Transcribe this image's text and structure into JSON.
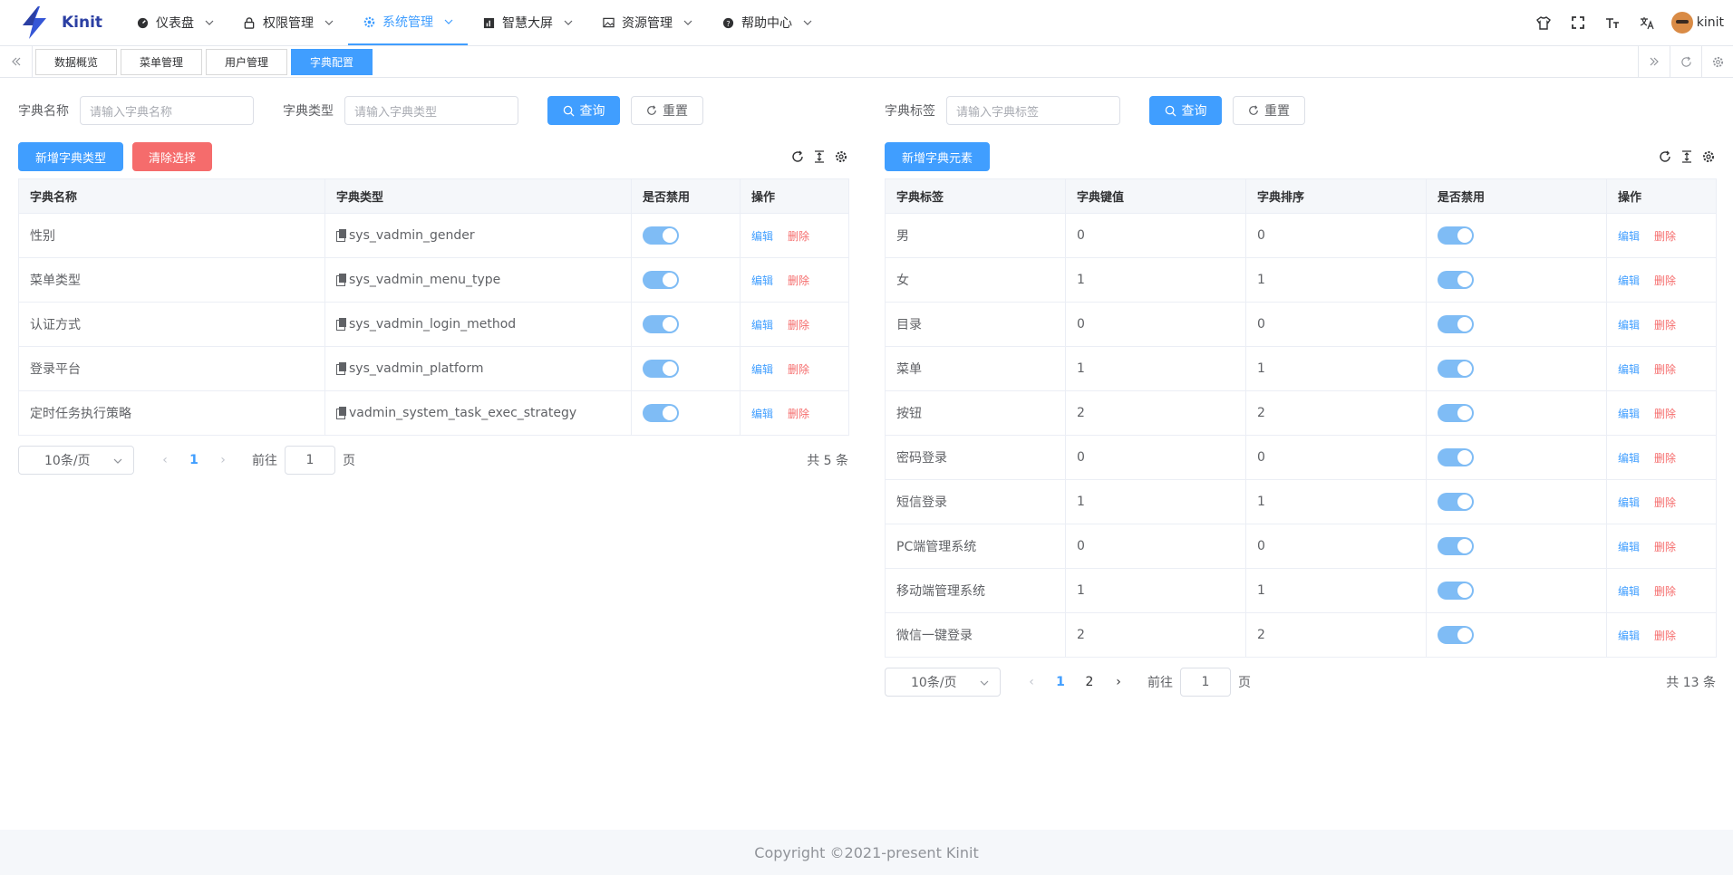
{
  "app": {
    "brand": "Kinit",
    "username": "kinit"
  },
  "menu": [
    {
      "label": "仪表盘",
      "icon": "dashboard-icon",
      "active": false
    },
    {
      "label": "权限管理",
      "icon": "lock-icon",
      "active": false
    },
    {
      "label": "系统管理",
      "icon": "gear-icon",
      "active": true
    },
    {
      "label": "智慧大屏",
      "icon": "chart-icon",
      "active": false
    },
    {
      "label": "资源管理",
      "icon": "image-icon",
      "active": false
    },
    {
      "label": "帮助中心",
      "icon": "question-icon",
      "active": false
    }
  ],
  "tags": [
    {
      "label": "数据概览",
      "active": false
    },
    {
      "label": "菜单管理",
      "active": false
    },
    {
      "label": "用户管理",
      "active": false
    },
    {
      "label": "字典配置",
      "active": true
    }
  ],
  "left": {
    "filters": {
      "name_label": "字典名称",
      "name_placeholder": "请输入字典名称",
      "type_label": "字典类型",
      "type_placeholder": "请输入字典类型",
      "query": "查询",
      "reset": "重置"
    },
    "buttons": {
      "add": "新增字典类型",
      "clear": "清除选择"
    },
    "columns": [
      "字典名称",
      "字典类型",
      "是否禁用",
      "操作"
    ],
    "rows": [
      {
        "name": "性别",
        "type": "sys_vadmin_gender"
      },
      {
        "name": "菜单类型",
        "type": "sys_vadmin_menu_type"
      },
      {
        "name": "认证方式",
        "type": "sys_vadmin_login_method"
      },
      {
        "name": "登录平台",
        "type": "sys_vadmin_platform"
      },
      {
        "name": "定时任务执行策略",
        "type": "vadmin_system_task_exec_strategy"
      }
    ],
    "pager": {
      "size": "10条/页",
      "page": "1",
      "goto": "前往",
      "goto_value": "1",
      "unit": "页",
      "total": "共 5 条"
    }
  },
  "right": {
    "filters": {
      "label_label": "字典标签",
      "label_placeholder": "请输入字典标签",
      "query": "查询",
      "reset": "重置"
    },
    "buttons": {
      "add": "新增字典元素"
    },
    "columns": [
      "字典标签",
      "字典键值",
      "字典排序",
      "是否禁用",
      "操作"
    ],
    "rows": [
      {
        "label": "男",
        "value": "0",
        "order": "0"
      },
      {
        "label": "女",
        "value": "1",
        "order": "1"
      },
      {
        "label": "目录",
        "value": "0",
        "order": "0"
      },
      {
        "label": "菜单",
        "value": "1",
        "order": "1"
      },
      {
        "label": "按钮",
        "value": "2",
        "order": "2"
      },
      {
        "label": "密码登录",
        "value": "0",
        "order": "0"
      },
      {
        "label": "短信登录",
        "value": "1",
        "order": "1"
      },
      {
        "label": "PC端管理系统",
        "value": "0",
        "order": "0"
      },
      {
        "label": "移动端管理系统",
        "value": "1",
        "order": "1"
      },
      {
        "label": "微信一键登录",
        "value": "2",
        "order": "2"
      }
    ],
    "pager": {
      "size": "10条/页",
      "page1": "1",
      "page2": "2",
      "goto": "前往",
      "goto_value": "1",
      "unit": "页",
      "total": "共 13 条"
    }
  },
  "ops": {
    "edit": "编辑",
    "delete": "删除"
  },
  "footer": {
    "text": "Copyright ©2021-present Kinit"
  },
  "colors": {
    "primary": "#409eff",
    "danger": "#f56c6c",
    "brand": "#2b3fa3"
  }
}
